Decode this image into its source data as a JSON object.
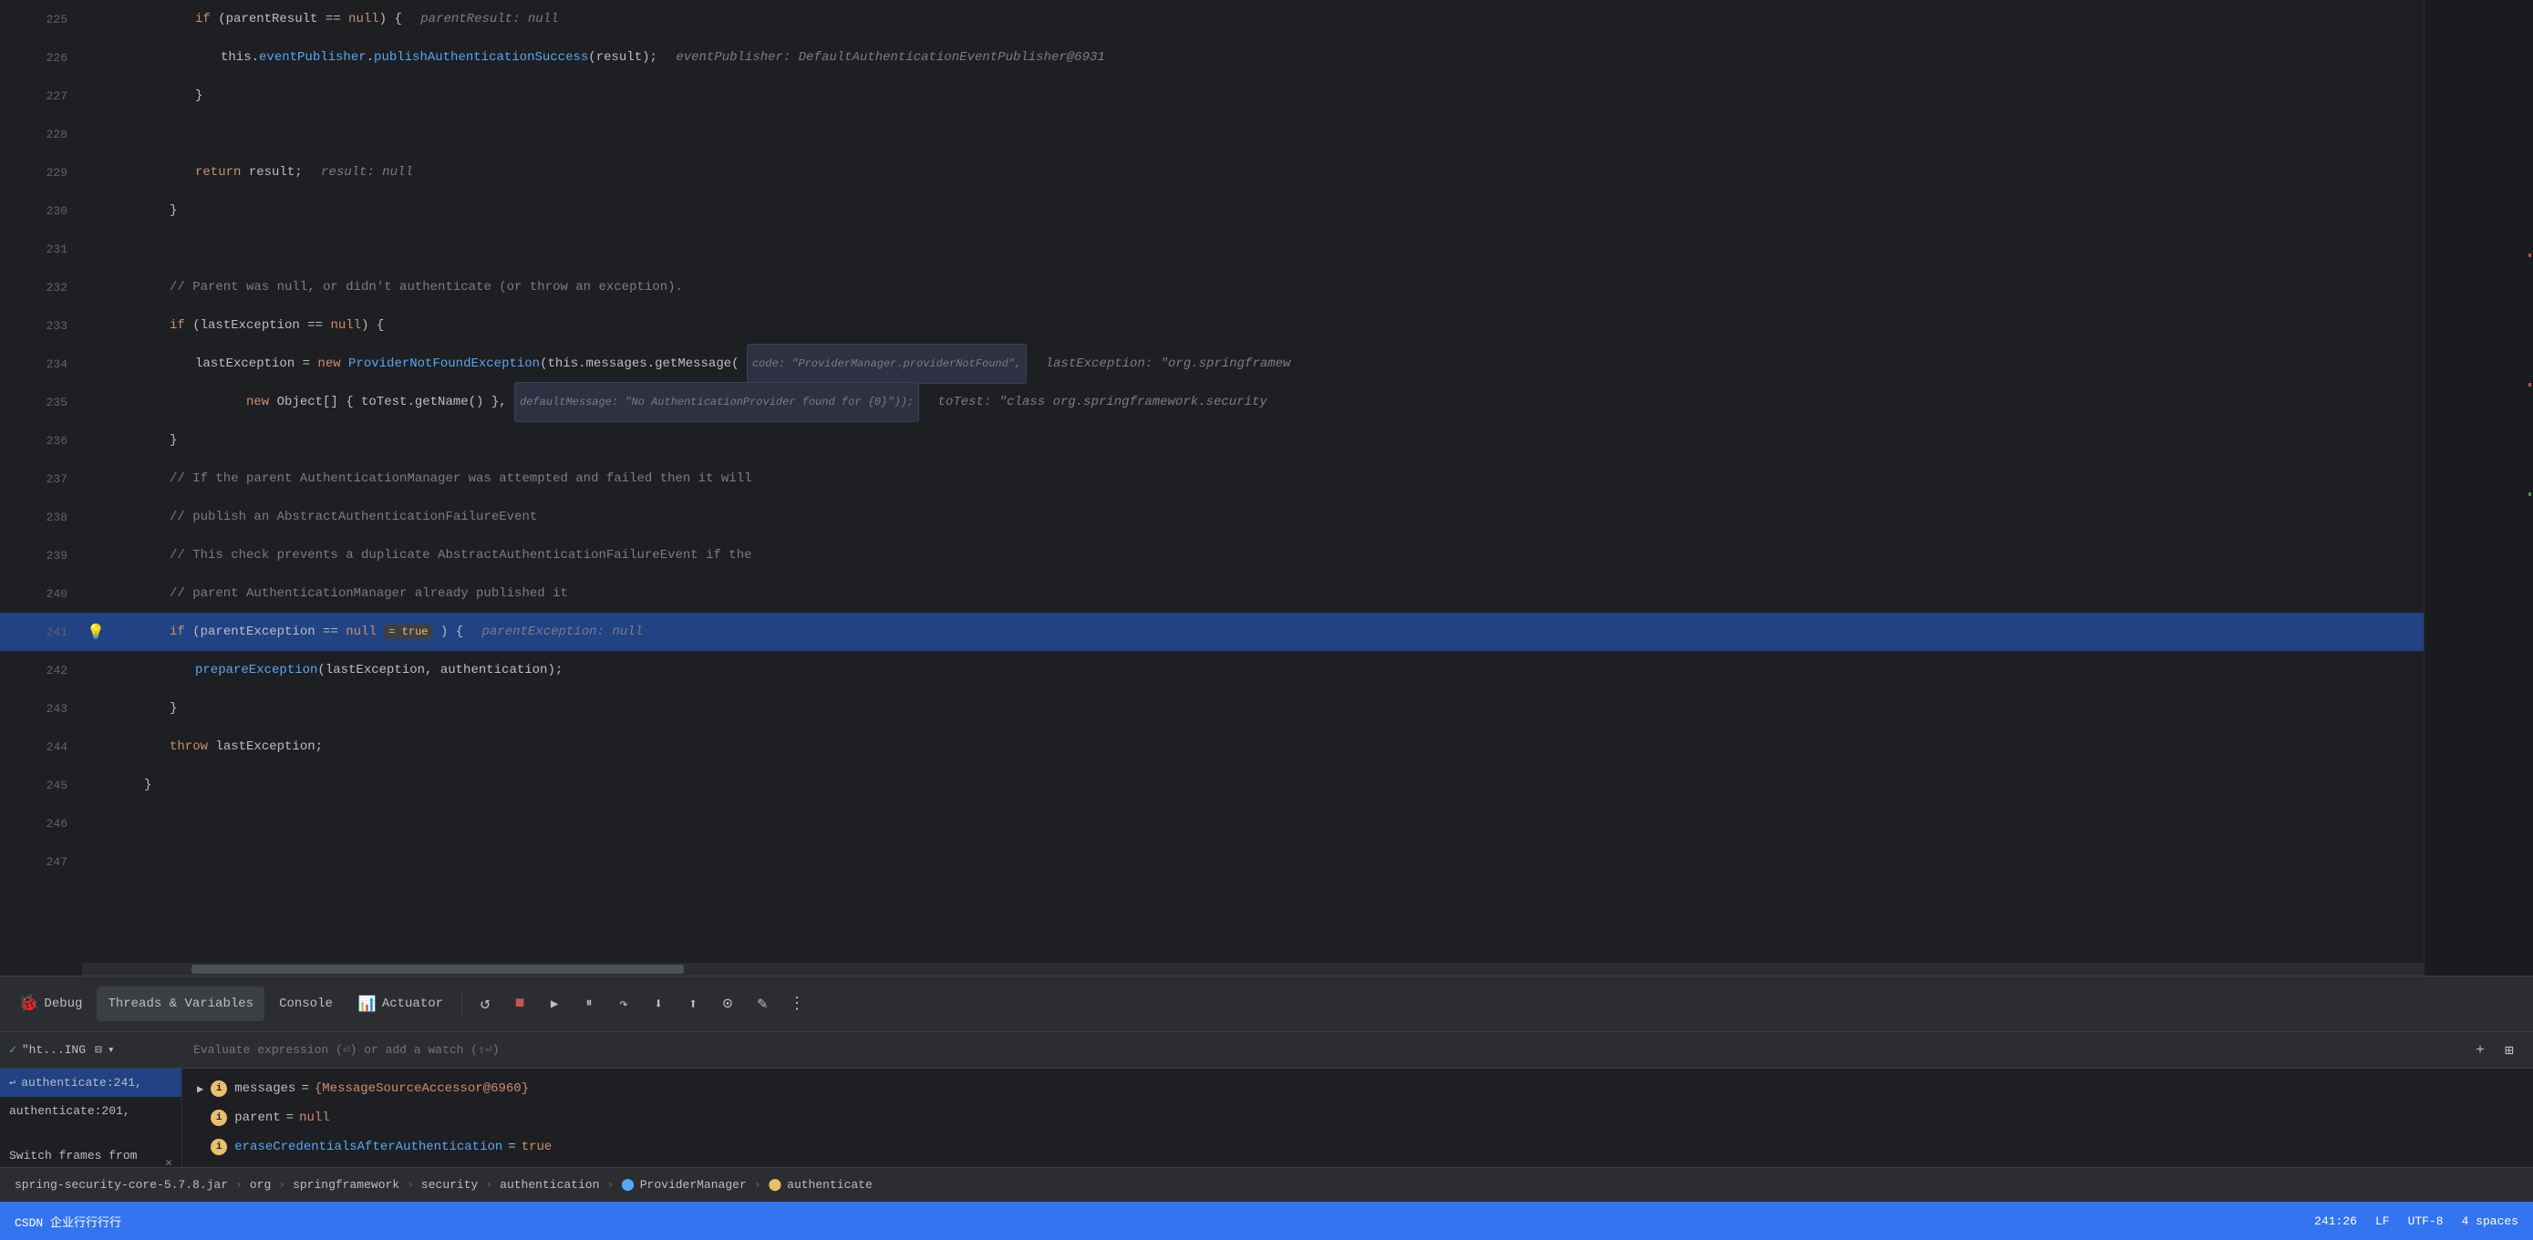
{
  "editor": {
    "lines": [
      {
        "num": "225",
        "indent": 3,
        "content_html": "<span class='kw'>if</span> (parentResult == <span class='kw'>null</span>) {  <span class='hint'>parentResult: null</span>"
      },
      {
        "num": "226",
        "indent": 4,
        "content_html": "<span class='var'>this</span>.<span class='fn'>eventPublisher</span>.<span class='fn'>publishAuthenticationSuccess</span>(result);  <span class='hint'>eventPublisher: DefaultAuthenticationEventPublisher@6931</span>"
      },
      {
        "num": "227",
        "indent": 3,
        "content_html": "}"
      },
      {
        "num": "228",
        "indent": 0,
        "content_html": ""
      },
      {
        "num": "229",
        "indent": 3,
        "content_html": "<span class='kw'>return</span> result;  <span class='hint'>result: null</span>"
      },
      {
        "num": "230",
        "indent": 2,
        "content_html": "}"
      },
      {
        "num": "231",
        "indent": 0,
        "content_html": ""
      },
      {
        "num": "232",
        "indent": 2,
        "content_html": "<span class='cm'>// Parent was null, or didn't authenticate (or throw an exception).</span>"
      },
      {
        "num": "233",
        "indent": 2,
        "content_html": "<span class='kw'>if</span> (lastException == <span class='kw'>null</span>) {"
      },
      {
        "num": "234",
        "indent": 3,
        "content_html": "lastException = <span class='kw'>new</span> <span class='fn'>ProviderNotFoundException</span>(<span class='var'>this</span>.messages.getMessage( <span class='inline-hint-box'>code: \"ProviderManager.providerNotFound\",</span>  <span class='hint'>lastException: \"org.springframew</span>"
      },
      {
        "num": "235",
        "indent": 5,
        "content_html": "<span class='kw'>new</span> Object[] { toTest.getName() }, <span class='inline-hint-box'>defaultMessage: \"No AuthenticationProvider found for {0}\"));</span>  <span class='hint'>toTest: \"class org.springframework.security</span>"
      },
      {
        "num": "236",
        "indent": 2,
        "content_html": "}"
      },
      {
        "num": "237",
        "indent": 2,
        "content_html": "<span class='cm'>// If the parent AuthenticationManager was attempted and failed then it will</span>"
      },
      {
        "num": "238",
        "indent": 2,
        "content_html": "<span class='cm'>// publish an AbstractAuthenticationFailureEvent</span>"
      },
      {
        "num": "239",
        "indent": 2,
        "content_html": "<span class='cm'>// This check prevents a duplicate AbstractAuthenticationFailureEvent if the</span>"
      },
      {
        "num": "240",
        "indent": 2,
        "content_html": "<span class='cm'>// parent AuthenticationManager already published it</span>"
      },
      {
        "num": "241",
        "indent": 2,
        "content_html": "<span class='kw'>if</span> (parentException == <span class='kw'>null</span> <span class='null-badge'>= true</span> ) {  <span class='hint'>parentException: null</span>",
        "highlighted": true,
        "has_bulb": true
      },
      {
        "num": "242",
        "indent": 3,
        "content_html": "<span class='fn'>prepareException</span>(lastException, authentication);"
      },
      {
        "num": "243",
        "indent": 2,
        "content_html": "}"
      },
      {
        "num": "244",
        "indent": 2,
        "content_html": "<span class='kw'>throw</span> lastException;"
      },
      {
        "num": "245",
        "indent": 1,
        "content_html": "}"
      },
      {
        "num": "246",
        "indent": 0,
        "content_html": ""
      },
      {
        "num": "247",
        "indent": 0,
        "content_html": ""
      }
    ]
  },
  "debug_toolbar": {
    "tabs": [
      {
        "id": "debug",
        "label": "Debug",
        "icon": "🐞",
        "active": true
      },
      {
        "id": "threads",
        "label": "Threads & Variables",
        "active": false
      },
      {
        "id": "console",
        "label": "Console",
        "active": false
      },
      {
        "id": "actuator",
        "label": "Actuator",
        "icon": "📊",
        "active": false
      }
    ],
    "buttons": [
      {
        "id": "rerun",
        "icon": "↺",
        "tooltip": "Rerun"
      },
      {
        "id": "stop",
        "icon": "■",
        "tooltip": "Stop"
      },
      {
        "id": "resume",
        "icon": "▶",
        "tooltip": "Resume Program"
      },
      {
        "id": "pause",
        "icon": "⏸",
        "tooltip": "Pause"
      },
      {
        "id": "step-over",
        "icon": "↷",
        "tooltip": "Step Over"
      },
      {
        "id": "step-into",
        "icon": "↓",
        "tooltip": "Step Into"
      },
      {
        "id": "step-out",
        "icon": "↑",
        "tooltip": "Step Out"
      },
      {
        "id": "run-to-cursor",
        "icon": "⊙",
        "tooltip": "Run to Cursor"
      },
      {
        "id": "evaluate",
        "icon": "✎",
        "tooltip": "Evaluate Expression"
      },
      {
        "id": "more",
        "icon": "⋮",
        "tooltip": "More"
      }
    ]
  },
  "frames_panel": {
    "header_label": "\"ht...ING",
    "frames": [
      {
        "label": "authenticate:241,",
        "selected": true
      },
      {
        "label": "authenticate:201,",
        "selected": false
      }
    ],
    "switch_frames_label": "Switch frames from ...",
    "close_label": "✕"
  },
  "variables_panel": {
    "evaluate_placeholder": "Evaluate expression (⏎) or add a watch (⇧⏎)",
    "variables": [
      {
        "name": "messages",
        "value": "= {MessageSourceAccessor@6960}",
        "expandable": true
      },
      {
        "name": "parent",
        "value": "= null",
        "expandable": false
      },
      {
        "name": "eraseCredentialsAfterAuthentication",
        "value": "= true",
        "expandable": false
      }
    ]
  },
  "breadcrumb": {
    "items": [
      "spring-security-core-5.7.8.jar",
      "org",
      "springframework",
      "security",
      "authentication",
      "ProviderManager",
      "authenticate"
    ],
    "separators": [
      ">",
      ">",
      ">",
      ">",
      ">",
      ">"
    ]
  },
  "status_bar": {
    "left_items": [
      "CSDN 企业行行行行"
    ],
    "right_items": [
      "241:26",
      "LF",
      "UTF-8",
      "4 spaces"
    ]
  }
}
